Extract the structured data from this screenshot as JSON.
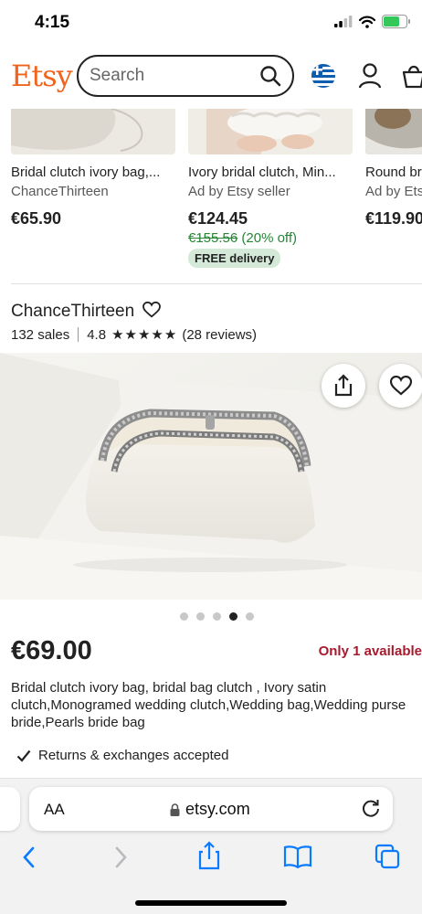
{
  "status": {
    "time": "4:15"
  },
  "header": {
    "logo": "Etsy",
    "search_placeholder": "Search"
  },
  "carousel": [
    {
      "title": "Bridal clutch ivory bag,...",
      "seller": "ChanceThirteen",
      "price": "€65.90"
    },
    {
      "title": "Ivory bridal clutch, Min...",
      "seller": "Ad by Etsy seller",
      "price": "€124.45",
      "old_price": "€155.56",
      "discount": "(20% off)",
      "badge": "FREE delivery"
    },
    {
      "title": "Round br",
      "seller": "Ad by Ets",
      "price": "€119.90"
    }
  ],
  "shop": {
    "name": "ChanceThirteen",
    "sales": "132 sales",
    "rating": "4.8",
    "reviews": "(28 reviews)"
  },
  "product": {
    "price": "€69.00",
    "stock": "Only 1 available",
    "description": "Bridal clutch ivory bag, bridal bag clutch , Ivory satin clutch,Monogramed wedding clutch,Wedding bag,Wedding purse bride,Pearls bride bag",
    "returns": "Returns & exchanges accepted",
    "image_count": 5,
    "active_image_index": 3
  },
  "browser": {
    "aa_label": "AA",
    "url": "etsy.com"
  },
  "colors": {
    "brand": "#F1641E",
    "sale_green": "#258635",
    "stock_red": "#A61A2E",
    "ios_blue": "#0a7aff"
  }
}
